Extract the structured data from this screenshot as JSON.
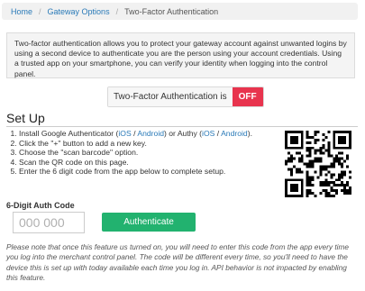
{
  "breadcrumb": {
    "home": "Home",
    "gateway": "Gateway Options",
    "current": "Two-Factor Authentication"
  },
  "info_text": "Two-factor authentication allows you to protect your gateway account against unwanted logins by using a second device to authenticate you are the person using your account credentials. Using a trusted app on your smartphone, you can verify your identity when logging into the control panel.",
  "toggle": {
    "label": "Two-Factor Authentication is",
    "state": "OFF",
    "state_color": "#e8344e"
  },
  "setup": {
    "title": "Set Up",
    "step1_prefix": "Install Google Authenticator (",
    "step1_ga_ios": "iOS",
    "step1_sep1": " / ",
    "step1_ga_android": "Android",
    "step1_mid": ") or Authy (",
    "step1_authy_ios": "iOS",
    "step1_sep2": " / ",
    "step1_authy_android": "Android",
    "step1_suffix": ").",
    "step2": "Click the \"+\" button to add a new key.",
    "step3": "Choose the \"scan barcode\" option.",
    "step4": "Scan the QR code on this page.",
    "step5": "Enter the 6 digit code from the app below to complete setup."
  },
  "auth": {
    "label": "6-Digit Auth Code",
    "placeholder": "000 000",
    "button": "Authenticate",
    "button_color": "#22b26f"
  },
  "note": "Please note that once this feature us turned on, you will need to enter this code from the app every time you log into the merchant control panel. The code will be different every time, so you'll need to have the device this is set up with today available each time you log in. API behavior is not impacted by enabling this feature.",
  "link_color": "#2a7ab8"
}
